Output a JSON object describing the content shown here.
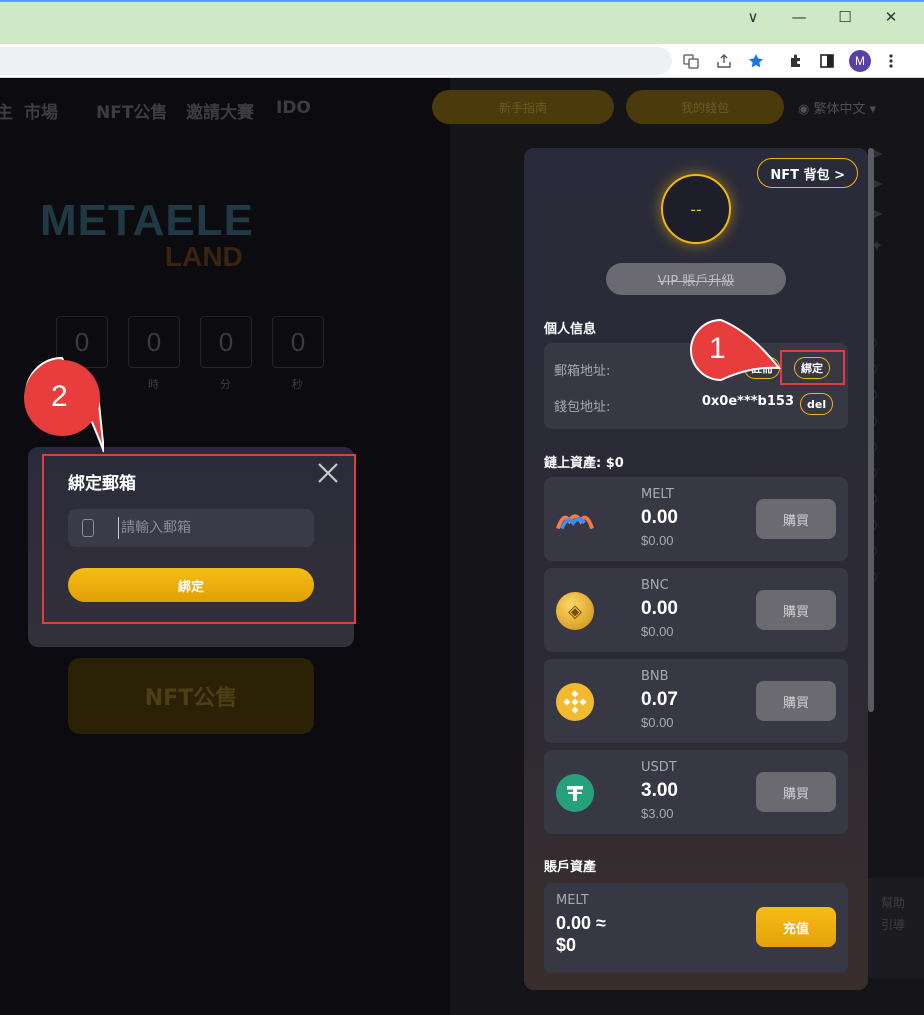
{
  "browser": {
    "window_controls": {
      "collapse": "∨",
      "minimize": "—",
      "maximize": "☐",
      "close": "✕"
    },
    "profile_initial": "M"
  },
  "site": {
    "nav": [
      "市場",
      "NFT公售",
      "邀請大賽",
      "IDO"
    ],
    "nav_prefix": "主",
    "header_buttons": [
      "新手指南",
      "我的錢包"
    ],
    "language": "繁体中文",
    "logo_text": "METAELE",
    "logo_sub": "LAND",
    "countdown": {
      "values": [
        "0",
        "0",
        "0",
        "0"
      ],
      "units": [
        "時",
        "分",
        "秒"
      ]
    },
    "nft_sale_button": "NFT公售",
    "help_labels": [
      "幫助",
      "引導"
    ]
  },
  "wallet": {
    "nft_bag_button": "NFT 背包 >",
    "vip_level": "--",
    "vip_upgrade_button": "VIP 賬戶升級",
    "personal_info_title": "個人信息",
    "email_label": "郵箱地址:",
    "register_button": "註冊",
    "bind_button": "綁定",
    "wallet_label": "錢包地址:",
    "wallet_address": "0x0e***b153",
    "del_button": "del",
    "onchain_title": "鏈上資產: $0",
    "assets": [
      {
        "name": "MELT",
        "amount": "0.00",
        "usd": "$0.00",
        "buy": "購買",
        "color": "#ffffff"
      },
      {
        "name": "BNC",
        "amount": "0.00",
        "usd": "$0.00",
        "buy": "購買",
        "color": "#e7b526"
      },
      {
        "name": "BNB",
        "amount": "0.07",
        "usd": "$0.00",
        "buy": "購買",
        "color": "#f3ba2f"
      },
      {
        "name": "USDT",
        "amount": "3.00",
        "usd": "$3.00",
        "buy": "購買",
        "color": "#26a17b"
      }
    ],
    "account_title": "賬戶資產",
    "account_asset": {
      "name": "MELT",
      "amount": "0.00 ≈",
      "usd": "$0",
      "topup": "充值"
    }
  },
  "modal": {
    "title": "綁定郵箱",
    "email_placeholder": "請輸入郵箱",
    "email_value": "",
    "submit_button": "綁定"
  },
  "annotations": {
    "step1": "1",
    "step2": "2",
    "marker_color": "#e83d3d"
  }
}
